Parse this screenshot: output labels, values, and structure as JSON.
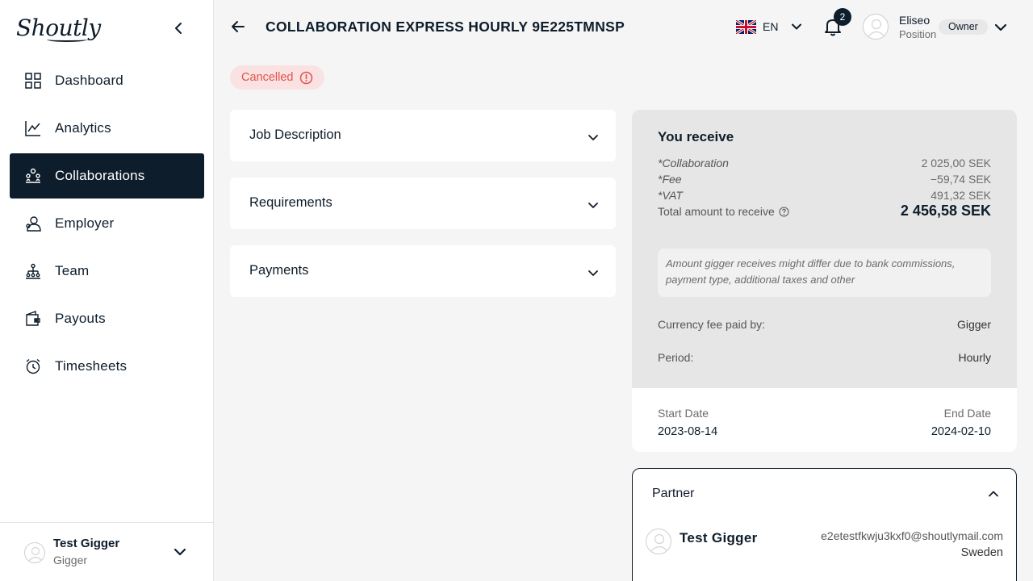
{
  "app": {
    "logo_text": "Shoutly"
  },
  "sidebar": {
    "items": [
      {
        "label": "Dashboard",
        "icon": "grid-icon"
      },
      {
        "label": "Analytics",
        "icon": "chart-line-icon"
      },
      {
        "label": "Collaborations",
        "icon": "collaborations-icon",
        "active": true
      },
      {
        "label": "Employer",
        "icon": "employer-icon"
      },
      {
        "label": "Team",
        "icon": "team-icon"
      },
      {
        "label": "Payouts",
        "icon": "wallet-icon"
      },
      {
        "label": "Timesheets",
        "icon": "stopwatch-icon"
      }
    ],
    "footer": {
      "name": "Test Gigger",
      "role": "Gigger"
    }
  },
  "header": {
    "title": "COLLABORATION EXPRESS HOURLY 9E225TMNSP",
    "language": "EN",
    "notifications_count": "2",
    "user": {
      "name": "Eliseo",
      "position": "Position",
      "role_badge": "Owner"
    }
  },
  "status": {
    "label": "Cancelled",
    "color": "#e0524a"
  },
  "sections": [
    {
      "label": "Job Description"
    },
    {
      "label": "Requirements"
    },
    {
      "label": "Payments"
    }
  ],
  "receive": {
    "title": "You receive",
    "rows": [
      {
        "label": "*Collaboration",
        "value": "2 025,00 SEK"
      },
      {
        "label": "*Fee",
        "value": "−59,74 SEK"
      },
      {
        "label": "*VAT",
        "value": "491,32 SEK"
      }
    ],
    "total_label": "Total amount to receive",
    "total_value": "2 456,58 SEK",
    "note": "Amount gigger receives might differ due to bank commissions, payment type, additional taxes and other",
    "currency_fee_label": "Currency fee paid by:",
    "currency_fee_value": "Gigger",
    "period_label": "Period:",
    "period_value": "Hourly"
  },
  "dates": {
    "start_label": "Start Date",
    "start_value": "2023-08-14",
    "end_label": "End Date",
    "end_value": "2024-02-10"
  },
  "partner": {
    "title": "Partner",
    "name": "Test Gigger",
    "email": "e2etestfkwju3kxf0@shoutlymail.com",
    "country": "Sweden"
  },
  "colors": {
    "brand_dark": "#0e1d2b",
    "status_cancelled_bg": "#fbe2e2"
  }
}
